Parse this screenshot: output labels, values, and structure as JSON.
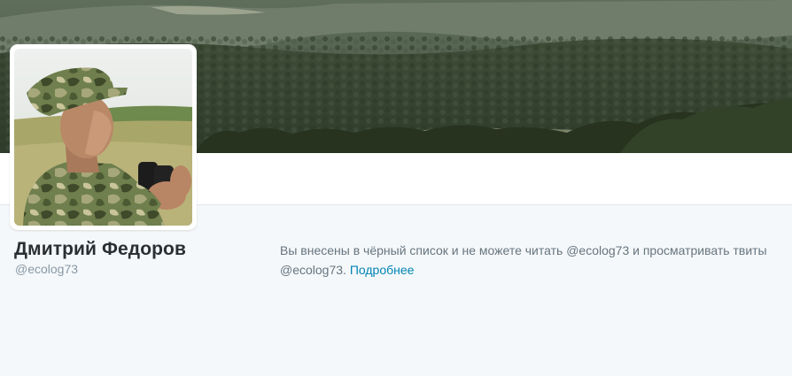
{
  "profile": {
    "name": "Дмитрий Федоров",
    "handle": "@ecolog73"
  },
  "blocked": {
    "message": "Вы внесены в чёрный список и не можете читать @ecolog73 и просматривать твиты @ecolog73.",
    "learn_more": "Подробнее"
  },
  "icons": {
    "header": "header-photo",
    "avatar": "profile-avatar-photo"
  },
  "colors": {
    "link": "#0084b4",
    "name": "#292f33",
    "muted": "#8899a6",
    "body": "#66757f",
    "background": "#f5f8fa"
  }
}
